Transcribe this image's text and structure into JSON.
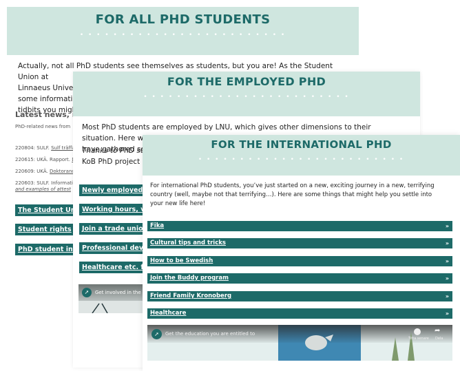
{
  "card1": {
    "title": "FOR ALL PHD STUDENTS",
    "dots": "• • • • • • • • • • • • • • • • • • • • • • • • •",
    "intro_l1": "Actually, not all PhD students see themselves as students, but you are! As the Student Union at",
    "intro_l2": "Linnaeus Univers",
    "intro_l3": "some informati",
    "intro_l4": "tidbits you migh",
    "news_heading": "Latest news, rep",
    "news_sub": "PhD-related news from",
    "news": [
      {
        "date": "220804: SULF.",
        "link": "Sulf träffar"
      },
      {
        "date": "220615: UKÄ. Rapport.",
        "link": "Do"
      },
      {
        "date": "220609: UKÄ.",
        "link": "Doktorand"
      },
      {
        "date": "220603: SULF. Informatio",
        "link": "and examples of attest"
      }
    ],
    "buttons": [
      "The Student Union",
      "Student rights",
      "PhD student influ"
    ]
  },
  "card2": {
    "title": "FOR THE EMPLOYED PHD",
    "dots": "• • • • • • • • • • • • • • • • • • • • • • • • •",
    "intro_l1": "Most PhD students are employed by LNU, which gives other dimensions to their situation. Here we",
    "intro_l2": "have gathered son",
    "thanks_l1": "Thanks to PhD stuc",
    "thanks_l2": "KoB PhD project roo",
    "buttons": [
      "Newly employed?",
      "Working hours, vaca",
      "Join a trade union!",
      "Professional develop",
      "Healthcare etc. for e"
    ],
    "video_title": "Get involved in the s"
  },
  "card3": {
    "title": "FOR THE INTERNATIONAL PHD",
    "dots": "• • • • • • • • • • • • • • • • • • • • • • • • •",
    "intro": "For international PhD students, you’ve just started on a new, exciting journey in a new, terrifying country (well, maybe not that terrifying…). Here are some things that might help you settle into your new life here!",
    "accordion": [
      "Fika",
      "Cultural tips and tricks",
      "How to be Swedish",
      "Join the Buddy program",
      "Friend Family Kronoberg",
      "Healthcare"
    ],
    "chevron": "»",
    "video_title": "Get the education you are entitled to",
    "video_watch_later": "Titta senare",
    "video_share": "Dela"
  },
  "colors": {
    "teal": "#1d6a68",
    "mint": "#cfe6df"
  }
}
